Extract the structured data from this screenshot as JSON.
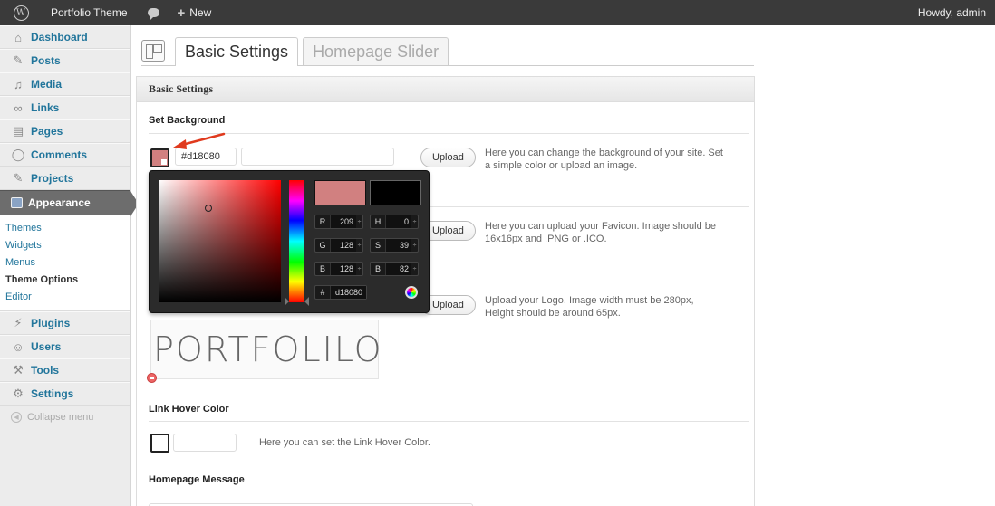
{
  "adminbar": {
    "site_name": "Portfolio Theme",
    "new_label": "New",
    "new_plus": "+",
    "howdy": "Howdy, admin",
    "wp_glyph": "W"
  },
  "sidebar": {
    "items": [
      {
        "label": "Dashboard",
        "icon": "dashboard-icon",
        "glyph": "⌂"
      },
      {
        "label": "Posts",
        "icon": "pin-icon",
        "glyph": "✎"
      },
      {
        "label": "Media",
        "icon": "media-icon",
        "glyph": "♫"
      },
      {
        "label": "Links",
        "icon": "link-icon",
        "glyph": "∞"
      },
      {
        "label": "Pages",
        "icon": "pages-icon",
        "glyph": "▤"
      },
      {
        "label": "Comments",
        "icon": "comment-icon",
        "glyph": "◯"
      },
      {
        "label": "Projects",
        "icon": "pin-icon",
        "glyph": "✎"
      },
      {
        "label": "Appearance",
        "icon": "appearance-icon",
        "glyph": ""
      }
    ],
    "submenu": [
      "Themes",
      "Widgets",
      "Menus",
      "Theme Options",
      "Editor"
    ],
    "items_after": [
      {
        "label": "Plugins",
        "icon": "plugin-icon",
        "glyph": "⚡"
      },
      {
        "label": "Users",
        "icon": "users-icon",
        "glyph": "☺"
      },
      {
        "label": "Tools",
        "icon": "tools-icon",
        "glyph": "⚒"
      },
      {
        "label": "Settings",
        "icon": "settings-icon",
        "glyph": "⚙"
      }
    ],
    "collapse": "Collapse menu",
    "collapse_glyph": "◀"
  },
  "tabs": [
    "Basic Settings",
    "Homepage Slider"
  ],
  "panel": {
    "title": "Basic Settings",
    "set_background": "Set Background",
    "bg_color_value": "#d18080",
    "upload_label": "Upload",
    "bg_desc": "Here you can change the background of your site. Set a simple color or upload an image.",
    "favicon_desc": "Here you can upload your Favicon. Image should be 16x16px and .PNG or .ICO.",
    "logo_desc": "Upload your Logo. Image width must be 280px, Height should be around 65px.",
    "logo_text": "PORTFOLILO",
    "link_hover_title": "Link Hover Color",
    "link_hover_desc": "Here you can set the Link Hover Color.",
    "homepage_message_title": "Homepage Message"
  },
  "picker": {
    "r_label": "R",
    "r": "209",
    "g_label": "G",
    "g": "128",
    "b_label": "B",
    "b": "128",
    "h_label": "H",
    "h": "0",
    "s_label": "S",
    "s": "39",
    "v_label": "B",
    "v": "82",
    "hex_label": "#",
    "hex": "d18080",
    "spin": "÷"
  },
  "colors": {
    "accent": "#21759b",
    "selected": "#d18080",
    "current": "#000000",
    "arrow": "#e03a1e"
  }
}
